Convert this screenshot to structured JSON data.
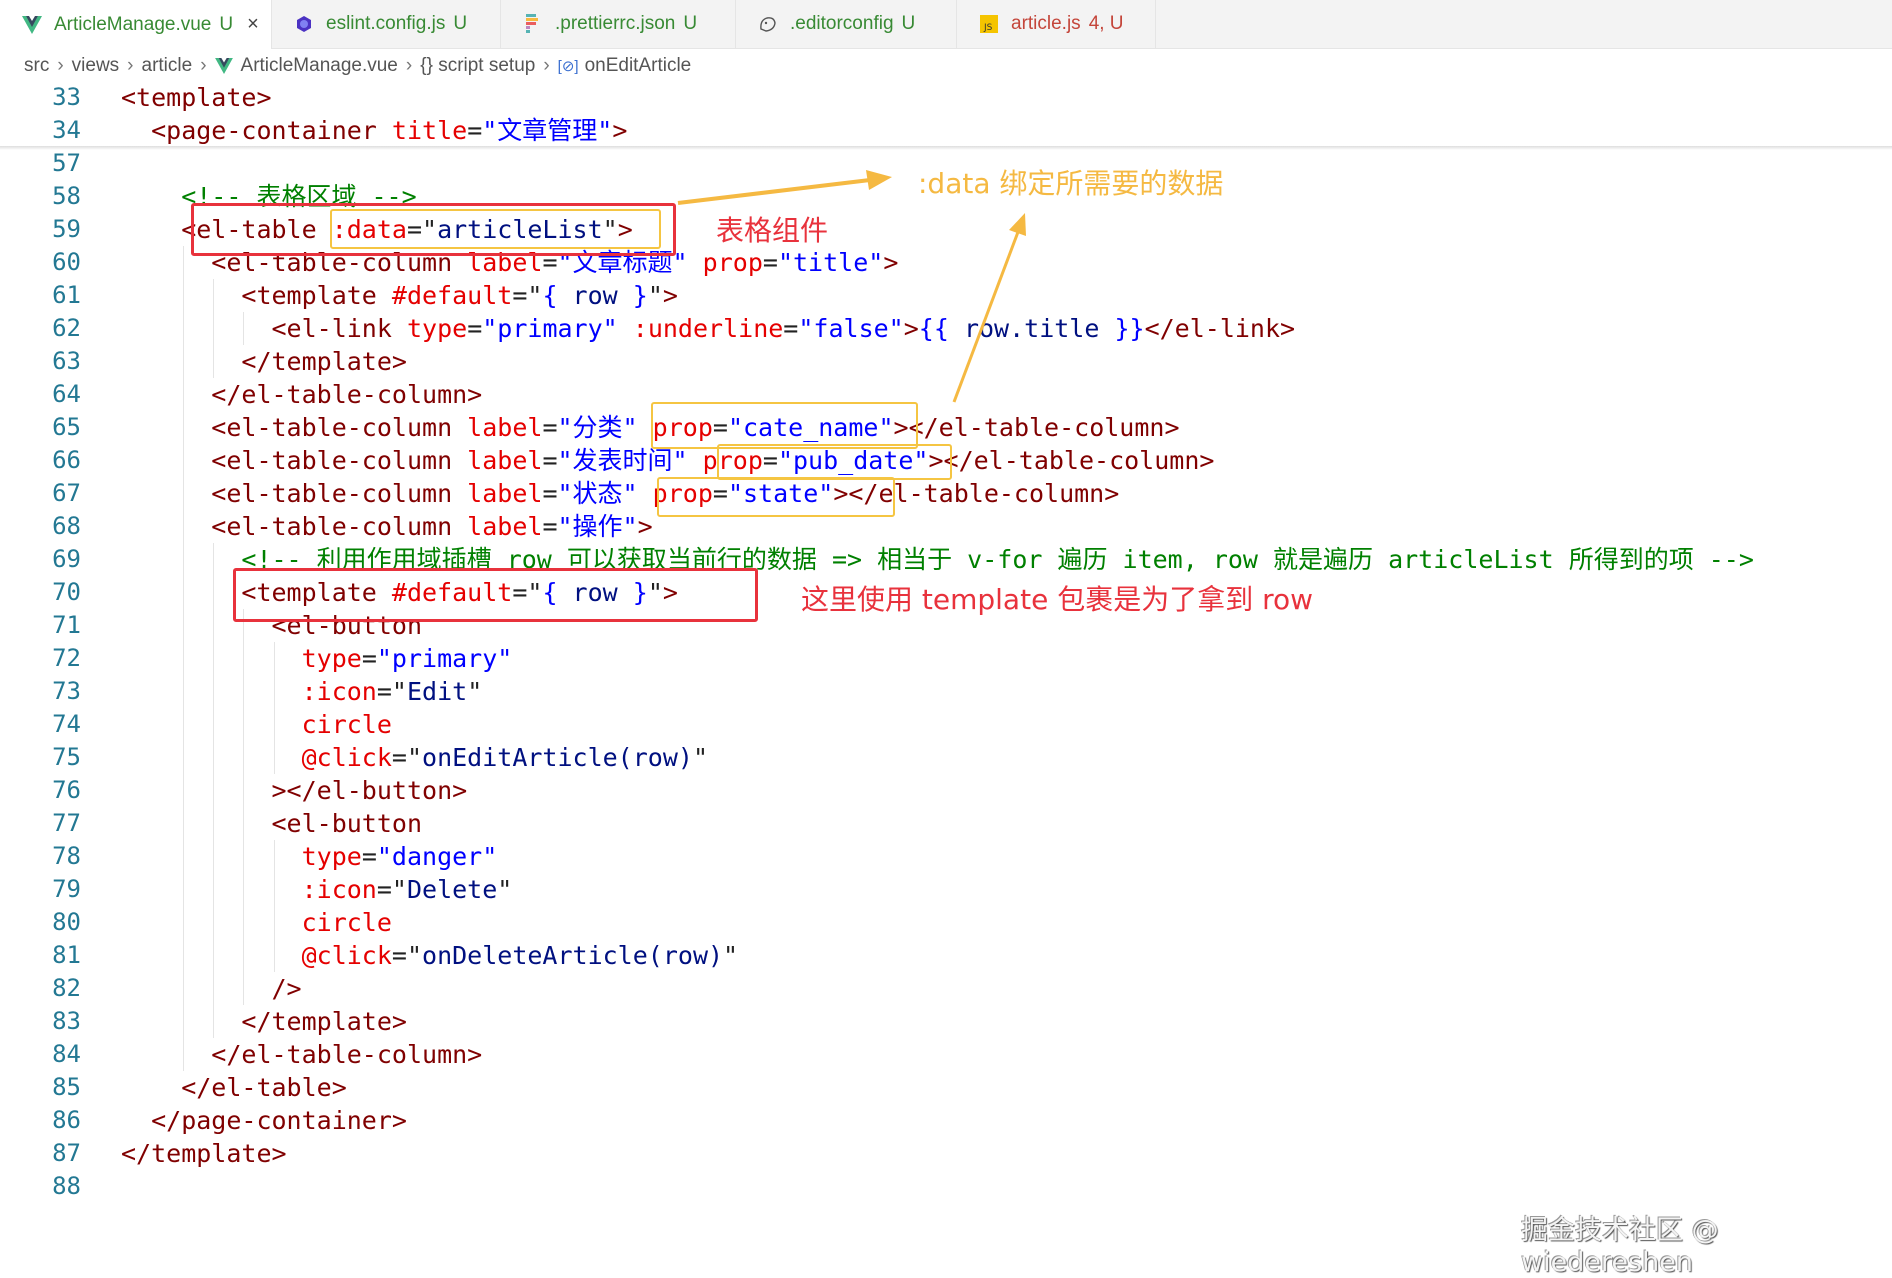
{
  "tabs": [
    {
      "name": "ArticleManage.vue",
      "status": "U",
      "icon": "vue-icon",
      "active": true,
      "close": "×"
    },
    {
      "name": "eslint.config.js",
      "status": "U",
      "icon": "eslint-icon"
    },
    {
      "name": ".prettierrc.json",
      "status": "U",
      "icon": "prettier-icon"
    },
    {
      "name": ".editorconfig",
      "status": "U",
      "icon": "editorconfig-icon"
    },
    {
      "name": "article.js",
      "status": "4, U",
      "icon": "js-icon"
    }
  ],
  "breadcrumb": [
    "src",
    "views",
    "article",
    "ArticleManage.vue",
    "{} script setup",
    "onEditArticle"
  ],
  "code": [
    {
      "n": "33",
      "i": 0,
      "tk": [
        [
          "t",
          "<template>"
        ]
      ]
    },
    {
      "n": "34",
      "i": 2,
      "tk": [
        [
          "t",
          "<page-container "
        ],
        [
          "a",
          "title"
        ],
        [
          "x",
          "="
        ],
        [
          "s",
          "\"文章管理\""
        ],
        [
          "t",
          ">"
        ]
      ]
    },
    {
      "n": "57",
      "i": 0,
      "tk": []
    },
    {
      "n": "58",
      "i": 4,
      "tk": [
        [
          "c",
          "<!-- 表格区域 -->"
        ]
      ]
    },
    {
      "n": "59",
      "i": 4,
      "tk": [
        [
          "t",
          "<el-table "
        ],
        [
          "a",
          ":data"
        ],
        [
          "x",
          "=\""
        ],
        [
          "e",
          "articleList"
        ],
        [
          "x",
          "\""
        ],
        [
          "t",
          ">"
        ]
      ]
    },
    {
      "n": "60",
      "i": 6,
      "tk": [
        [
          "t",
          "<el-table-column "
        ],
        [
          "a",
          "label"
        ],
        [
          "x",
          "="
        ],
        [
          "s",
          "\"文章标题\""
        ],
        [
          "x",
          " "
        ],
        [
          "a",
          "prop"
        ],
        [
          "x",
          "="
        ],
        [
          "s",
          "\"title\""
        ],
        [
          "t",
          ">"
        ]
      ]
    },
    {
      "n": "61",
      "i": 8,
      "tk": [
        [
          "t",
          "<template "
        ],
        [
          "a",
          "#default"
        ],
        [
          "x",
          "=\""
        ],
        [
          "s",
          "{ "
        ],
        [
          "e",
          "row"
        ],
        [
          "s",
          " }"
        ],
        [
          "x",
          "\""
        ],
        [
          "t",
          ">"
        ]
      ]
    },
    {
      "n": "62",
      "i": 10,
      "tk": [
        [
          "t",
          "<el-link "
        ],
        [
          "a",
          "type"
        ],
        [
          "x",
          "="
        ],
        [
          "s",
          "\"primary\""
        ],
        [
          "x",
          " "
        ],
        [
          "a",
          ":underline"
        ],
        [
          "x",
          "="
        ],
        [
          "s",
          "\"false\""
        ],
        [
          "t",
          ">"
        ],
        [
          "s",
          "{{ "
        ],
        [
          "e",
          "row.title"
        ],
        [
          "s",
          " }}"
        ],
        [
          "t",
          "</el-link>"
        ]
      ]
    },
    {
      "n": "63",
      "i": 8,
      "tk": [
        [
          "t",
          "</template>"
        ]
      ]
    },
    {
      "n": "64",
      "i": 6,
      "tk": [
        [
          "t",
          "</el-table-column>"
        ]
      ]
    },
    {
      "n": "65",
      "i": 6,
      "tk": [
        [
          "t",
          "<el-table-column "
        ],
        [
          "a",
          "label"
        ],
        [
          "x",
          "="
        ],
        [
          "s",
          "\"分类\""
        ],
        [
          "x",
          " "
        ],
        [
          "a",
          "prop"
        ],
        [
          "x",
          "="
        ],
        [
          "s",
          "\"cate_name\""
        ],
        [
          "t",
          "></el-table-column>"
        ]
      ]
    },
    {
      "n": "66",
      "i": 6,
      "tk": [
        [
          "t",
          "<el-table-column "
        ],
        [
          "a",
          "label"
        ],
        [
          "x",
          "="
        ],
        [
          "s",
          "\"发表时间\""
        ],
        [
          "x",
          " "
        ],
        [
          "a",
          "prop"
        ],
        [
          "x",
          "="
        ],
        [
          "s",
          "\"pub_date\""
        ],
        [
          "t",
          "></el-table-column>"
        ]
      ]
    },
    {
      "n": "67",
      "i": 6,
      "tk": [
        [
          "t",
          "<el-table-column "
        ],
        [
          "a",
          "label"
        ],
        [
          "x",
          "="
        ],
        [
          "s",
          "\"状态\""
        ],
        [
          "x",
          " "
        ],
        [
          "a",
          "prop"
        ],
        [
          "x",
          "="
        ],
        [
          "s",
          "\"state\""
        ],
        [
          "t",
          "></el-table-column>"
        ]
      ]
    },
    {
      "n": "68",
      "i": 6,
      "tk": [
        [
          "t",
          "<el-table-column "
        ],
        [
          "a",
          "label"
        ],
        [
          "x",
          "="
        ],
        [
          "s",
          "\"操作\""
        ],
        [
          "t",
          ">"
        ]
      ]
    },
    {
      "n": "69",
      "i": 8,
      "tk": [
        [
          "c",
          "<!-- 利用作用域插槽 row 可以获取当前行的数据 => 相当于 v-for 遍历 item, row 就是遍历 articleList 所得到的项 -->"
        ]
      ]
    },
    {
      "n": "70",
      "i": 8,
      "tk": [
        [
          "t",
          "<template "
        ],
        [
          "a",
          "#default"
        ],
        [
          "x",
          "=\""
        ],
        [
          "s",
          "{ "
        ],
        [
          "e",
          "row"
        ],
        [
          "s",
          " }"
        ],
        [
          "x",
          "\""
        ],
        [
          "t",
          ">"
        ]
      ]
    },
    {
      "n": "71",
      "i": 10,
      "tk": [
        [
          "t",
          "<el-button"
        ]
      ]
    },
    {
      "n": "72",
      "i": 12,
      "tk": [
        [
          "a",
          "type"
        ],
        [
          "x",
          "="
        ],
        [
          "s",
          "\"primary\""
        ]
      ]
    },
    {
      "n": "73",
      "i": 12,
      "tk": [
        [
          "a",
          ":icon"
        ],
        [
          "x",
          "=\""
        ],
        [
          "e",
          "Edit"
        ],
        [
          "x",
          "\""
        ]
      ]
    },
    {
      "n": "74",
      "i": 12,
      "tk": [
        [
          "a",
          "circle"
        ]
      ]
    },
    {
      "n": "75",
      "i": 12,
      "tk": [
        [
          "a",
          "@click"
        ],
        [
          "x",
          "=\""
        ],
        [
          "e",
          "onEditArticle(row)"
        ],
        [
          "x",
          "\""
        ]
      ]
    },
    {
      "n": "76",
      "i": 10,
      "tk": [
        [
          "t",
          "></el-button>"
        ]
      ]
    },
    {
      "n": "77",
      "i": 10,
      "tk": [
        [
          "t",
          "<el-button"
        ]
      ]
    },
    {
      "n": "78",
      "i": 12,
      "tk": [
        [
          "a",
          "type"
        ],
        [
          "x",
          "="
        ],
        [
          "s",
          "\"danger\""
        ]
      ]
    },
    {
      "n": "79",
      "i": 12,
      "tk": [
        [
          "a",
          ":icon"
        ],
        [
          "x",
          "=\""
        ],
        [
          "e",
          "Delete"
        ],
        [
          "x",
          "\""
        ]
      ]
    },
    {
      "n": "80",
      "i": 12,
      "tk": [
        [
          "a",
          "circle"
        ]
      ]
    },
    {
      "n": "81",
      "i": 12,
      "tk": [
        [
          "a",
          "@click"
        ],
        [
          "x",
          "=\""
        ],
        [
          "e",
          "onDeleteArticle(row)"
        ],
        [
          "x",
          "\""
        ]
      ]
    },
    {
      "n": "82",
      "i": 10,
      "tk": [
        [
          "t",
          "/>"
        ]
      ]
    },
    {
      "n": "83",
      "i": 8,
      "tk": [
        [
          "t",
          "</template>"
        ]
      ]
    },
    {
      "n": "84",
      "i": 6,
      "tk": [
        [
          "t",
          "</el-table-column>"
        ]
      ]
    },
    {
      "n": "85",
      "i": 4,
      "tk": [
        [
          "t",
          "</el-table>"
        ]
      ]
    },
    {
      "n": "86",
      "i": 2,
      "tk": [
        [
          "t",
          "</page-container>"
        ]
      ]
    },
    {
      "n": "87",
      "i": 0,
      "tk": [
        [
          "t",
          "</template>"
        ]
      ]
    },
    {
      "n": "88",
      "i": 0,
      "tk": []
    }
  ],
  "annotations": {
    "table_component": "表格组件",
    "data_binding": ":data 绑定所需要的数据",
    "template_note": "这里使用 template 包裹是为了拿到 row",
    "red_color": "#e8323c",
    "orange_color": "#f5b942"
  },
  "watermark": "掘金技术社区 @ wiedereshen"
}
